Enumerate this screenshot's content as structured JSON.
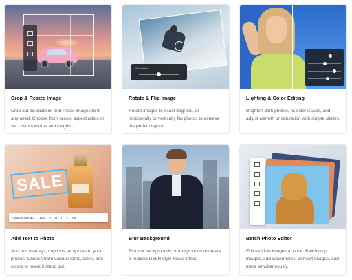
{
  "cards": [
    {
      "title": "Crop & Resize Image",
      "desc": "Crop out distractions and resize images to fit any need. Choose from preset aspect ratios or set custom widths and heights."
    },
    {
      "title": "Rotate & Flip Image",
      "desc": "Rotate images to exact degrees, or horizontally or vertically flip photos to achieve the perfect layout.",
      "panel_label": "Straighten"
    },
    {
      "title": "Lighting & Color Editing",
      "desc": "Brighten dark photos, fix color issues, and adjust warmth or saturation with simple sliders."
    },
    {
      "title": "Add Text to Photo",
      "desc": "Add text overlays, captions, or quotes to your photos. Choose from various fonts, sizes, and colors to make it stand out.",
      "overlay_text": "SALE",
      "font_name": "Poppins SemiB...",
      "font_size": "100",
      "toolbar_glyphs": [
        "A",
        "B",
        "I",
        "≡",
        "Aa"
      ]
    },
    {
      "title": "Blur Background",
      "desc": "Blur out backgrounds or foregrounds to create a realistic DSLR style focus effect."
    },
    {
      "title": "Batch Photo Editor",
      "desc": "Edit multiple images at once. Batch crop images, add watermarks, convert images, and more simultaneously."
    }
  ],
  "icons": {
    "crop": "crop-icon",
    "rotate": "rotate-icon",
    "sliders": "slider-icon",
    "text": "text-toolbar-icon",
    "batch": "batch-sidebar-icon"
  },
  "colors": {
    "sale_border": "#4fb6f3",
    "card_border": "#e7e9ee",
    "desc_text": "#5b6270"
  }
}
